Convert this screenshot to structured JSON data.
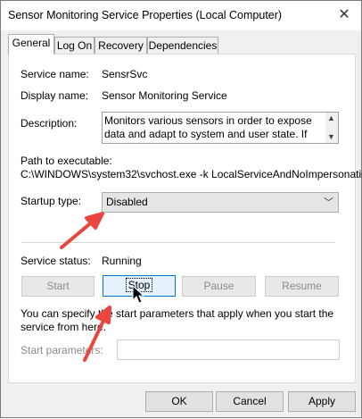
{
  "window": {
    "title": "Sensor Monitoring Service Properties (Local Computer)"
  },
  "tabs": [
    {
      "label": "General"
    },
    {
      "label": "Log On"
    },
    {
      "label": "Recovery"
    },
    {
      "label": "Dependencies"
    }
  ],
  "general": {
    "service_name_label": "Service name:",
    "service_name_value": "SensrSvc",
    "display_name_label": "Display name:",
    "display_name_value": "Sensor Monitoring Service",
    "description_label": "Description:",
    "description_value": "Monitors various sensors in order to expose data and adapt to system and user state.  If this service is",
    "path_label": "Path to executable:",
    "path_value": "C:\\WINDOWS\\system32\\svchost.exe -k LocalServiceAndNoImpersonation",
    "startup_type_label": "Startup type:",
    "startup_type_value": "Disabled",
    "service_status_label": "Service status:",
    "service_status_value": "Running",
    "buttons": {
      "start": "Start",
      "stop": "Stop",
      "pause": "Pause",
      "resume": "Resume"
    },
    "help_text": "You can specify the start parameters that apply when you start the service from here.",
    "start_params_label": "Start parameters:",
    "start_params_value": ""
  },
  "footer": {
    "ok": "OK",
    "cancel": "Cancel",
    "apply": "Apply"
  },
  "colors": {
    "annotation_arrow": "#e8463f",
    "focus_border": "#0078d7"
  },
  "icons": [
    "close-icon",
    "chevron-down-icon",
    "scroll-up-icon",
    "scroll-down-icon",
    "mouse-cursor-icon",
    "annotation-arrow-icon"
  ]
}
